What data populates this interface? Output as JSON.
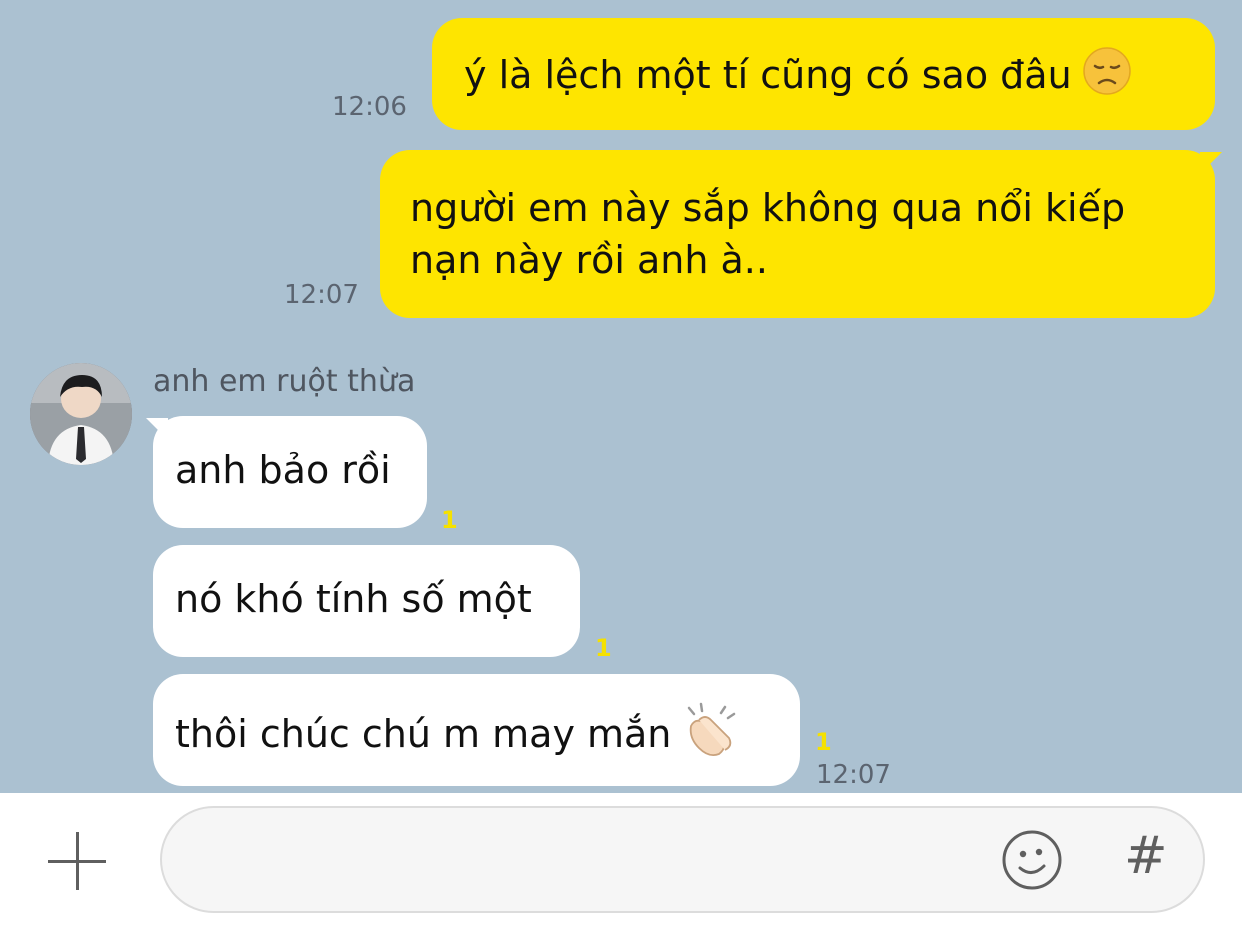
{
  "messages": {
    "out1": {
      "text": "ý là lệch một tí cũng có sao đâu",
      "emoji": "disappointed-face",
      "time": "12:06"
    },
    "out2": {
      "line1": "người em này sắp không qua nổi kiếp",
      "line2": "nạn này rồi anh à..",
      "time": "12:07"
    },
    "sender_name": "anh em ruột thừa",
    "in1": {
      "text": "anh bảo rồi",
      "unread": "1"
    },
    "in2": {
      "text": "nó khó tính số một",
      "unread": "1"
    },
    "in3": {
      "text": "thôi chúc chú m may mắn",
      "emoji": "clapping-hands",
      "unread": "1",
      "time": "12:07"
    }
  },
  "input_bar": {
    "placeholder": "",
    "hash_label": "#"
  },
  "colors": {
    "chat_background": "#abc1d1",
    "outgoing_bubble": "#fee500",
    "incoming_bubble": "#ffffff",
    "unread_count": "#f5e100"
  }
}
